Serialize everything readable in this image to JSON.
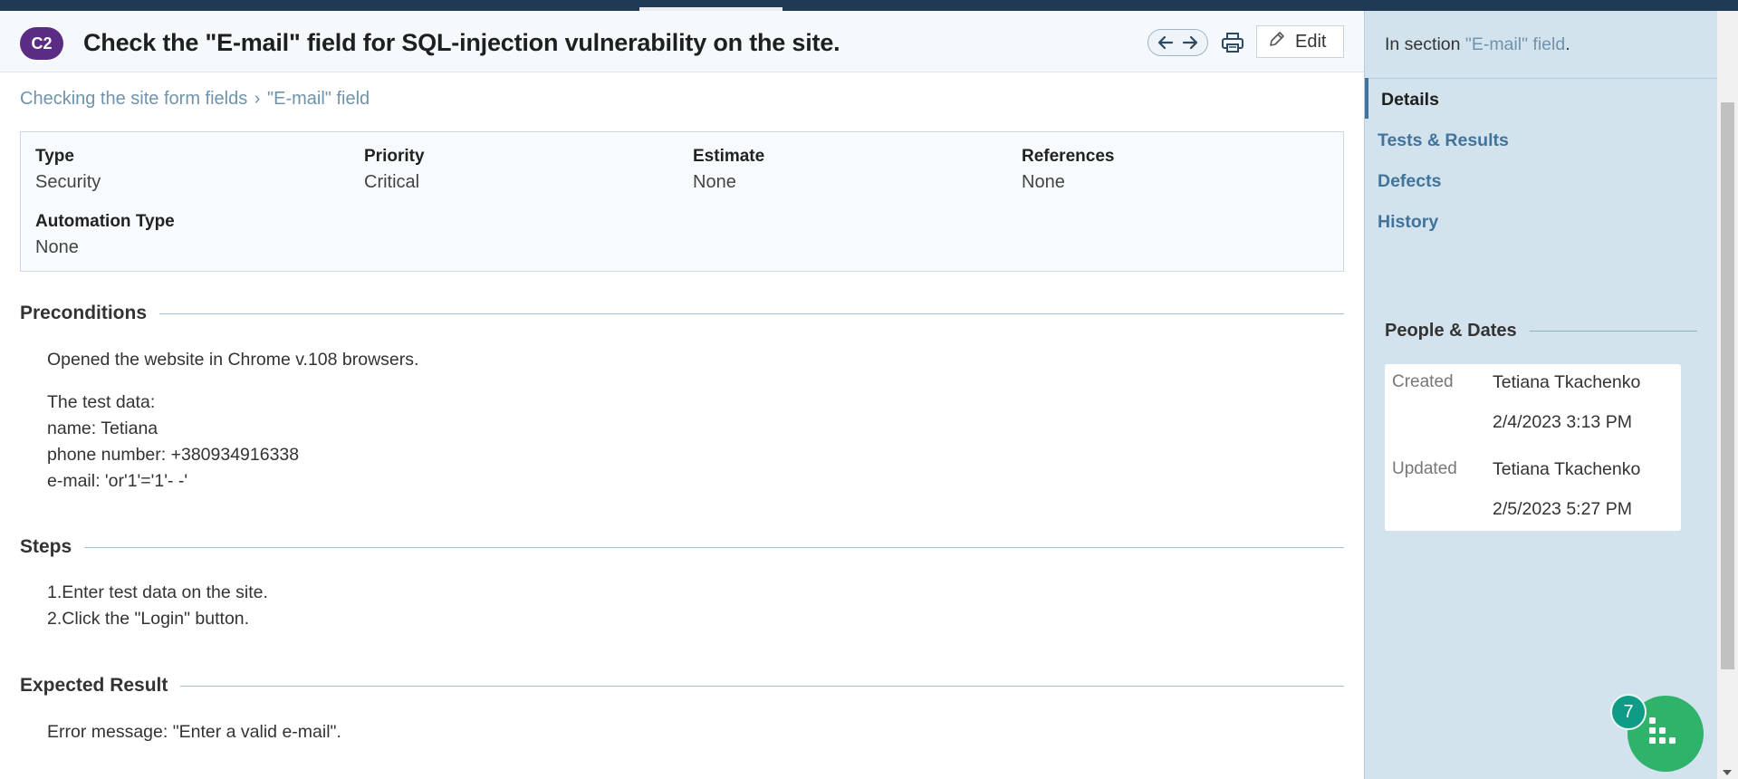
{
  "header": {
    "case_id": "C2",
    "title": "Check the \"E-mail\" field for SQL-injection vulnerability on the site.",
    "edit_label": "Edit"
  },
  "breadcrumb": {
    "parent": "Checking the site form fields",
    "separator": "›",
    "current": "\"E-mail\" field"
  },
  "fields": {
    "type": {
      "label": "Type",
      "value": "Security"
    },
    "priority": {
      "label": "Priority",
      "value": "Critical"
    },
    "estimate": {
      "label": "Estimate",
      "value": "None"
    },
    "references": {
      "label": "References",
      "value": "None"
    },
    "automation_type": {
      "label": "Automation Type",
      "value": "None"
    }
  },
  "preconditions": {
    "title": "Preconditions",
    "lines": [
      "Opened the website in Chrome v.108 browsers.",
      "The test data:",
      "name: Tetiana",
      "phone number: +380934916338",
      "e-mail: 'or'1'='1'- -'"
    ]
  },
  "steps": {
    "title": "Steps",
    "lines": [
      "1.Enter test data on the site.",
      "2.Click the \"Login\" button."
    ]
  },
  "expected": {
    "title": "Expected Result",
    "lines": [
      "Error message: \"Enter a valid e-mail\"."
    ]
  },
  "sidebar": {
    "section_prefix": "In section ",
    "section_link": "\"E-mail\" field",
    "section_suffix": ".",
    "nav": [
      {
        "label": "Details"
      },
      {
        "label": "Tests & Results"
      },
      {
        "label": "Defects"
      },
      {
        "label": "History"
      }
    ],
    "people_dates_title": "People & Dates",
    "created_label": "Created",
    "created_by": "Tetiana Tkachenko",
    "created_date": "2/4/2023 3:13 PM",
    "updated_label": "Updated",
    "updated_by": "Tetiana Tkachenko",
    "updated_date": "2/5/2023 5:27 PM"
  },
  "fab": {
    "count": "7"
  },
  "icons": [
    "arrow-left-icon",
    "arrow-right-icon",
    "printer-icon",
    "pencil-icon",
    "grid-apps-icon"
  ],
  "colors": {
    "badge": "#5b2c83",
    "link": "#6f93ad",
    "sidebar_bg": "#d3e3ee",
    "fab": "#2fb36b",
    "fab_badge": "#0f9c87",
    "topbar": "#1e3a55"
  }
}
